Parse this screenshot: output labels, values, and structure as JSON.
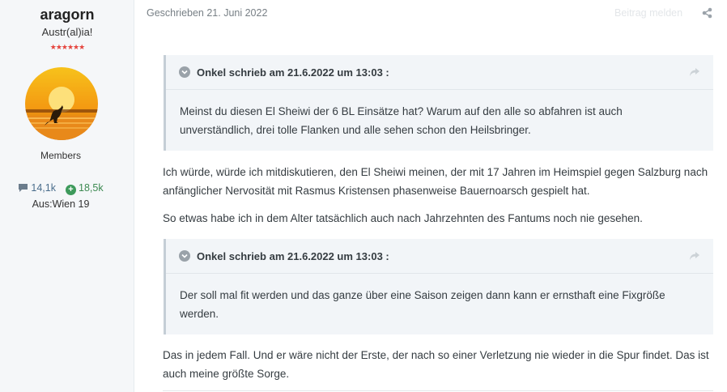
{
  "author": {
    "username": "aragorn",
    "title": "Austr(al)ia!",
    "rank_stars": "★★★★★★",
    "group": "Members",
    "posts": "14,1k",
    "reputation": "18,5k",
    "location": "Aus:Wien 19"
  },
  "post": {
    "date": "Geschrieben 21. Juni 2022",
    "report_label": "Beitrag melden",
    "quotes": [
      {
        "citation": "Onkel schrieb am 21.6.2022 um 13:03 :",
        "text": "Meinst du diesen El Sheiwi der 6 BL Einsätze hat? Warum auf den alle so abfahren ist auch unverständlich, drei tolle Flanken und alle sehen schon den Heilsbringer."
      },
      {
        "citation": "Onkel schrieb am 21.6.2022 um 13:03 :",
        "text": "Der soll mal fit werden und das ganze über eine Saison zeigen dann kann er ernsthaft eine Fixgröße werden."
      }
    ],
    "paragraphs": [
      "Ich würde, würde ich mitdiskutieren, den El Sheiwi meinen, der mit 17 Jahren im Heimspiel gegen Salzburg nach anfänglicher Nervosität mit Rasmus Kristensen phasenweise Bauernoarsch gespielt hat.",
      "So etwas habe ich in dem Alter tatsächlich auch nach Jahrzehnten des Fantums noch nie gesehen.",
      "Das in jedem Fall. Und er wäre nicht der Erste, der nach so einer Verletzung nie wieder in die Spur findet. Das ist auch meine größte Sorge."
    ]
  },
  "colors": {
    "sidebar_bg": "#f5f7f9",
    "quote_bg": "#f2f5f8",
    "stars": "#e5453e",
    "reputation": "#3d9a5b"
  }
}
